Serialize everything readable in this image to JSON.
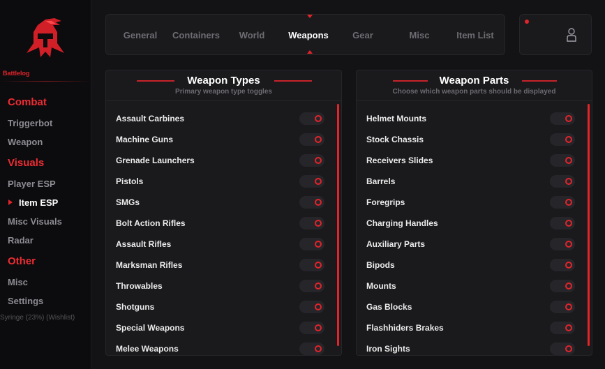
{
  "app": {
    "brand": "Battlelog"
  },
  "sidebar": {
    "sections": [
      {
        "label": "Combat",
        "items": [
          "Triggerbot",
          "Weapon"
        ]
      },
      {
        "label": "Visuals",
        "items": [
          "Player ESP",
          "Item ESP",
          "Misc Visuals",
          "Radar"
        ]
      },
      {
        "label": "Other",
        "items": [
          "Misc",
          "Settings"
        ]
      }
    ],
    "active_item": "Item ESP",
    "footer": "Syringe (23%) (Wishlist)"
  },
  "tabs": {
    "items": [
      "General",
      "Containers",
      "World",
      "Weapons",
      "Gear",
      "Misc",
      "Item List"
    ],
    "active": "Weapons"
  },
  "profile": {
    "icon": "user-icon"
  },
  "panels": {
    "left": {
      "title": "Weapon Types",
      "subtitle": "Primary weapon type toggles",
      "rows": [
        "Assault Carbines",
        "Machine Guns",
        "Grenade Launchers",
        "Pistols",
        "SMGs",
        "Bolt Action Rifles",
        "Assault Rifles",
        "Marksman Rifles",
        "Throwables",
        "Shotguns",
        "Special Weapons",
        "Melee Weapons"
      ]
    },
    "right": {
      "title": "Weapon Parts",
      "subtitle": "Choose which weapon parts should be displayed",
      "rows": [
        "Helmet Mounts",
        "Stock Chassis",
        "Receivers Slides",
        "Barrels",
        "Foregrips",
        "Charging Handles",
        "Auxiliary Parts",
        "Bipods",
        "Mounts",
        "Gas Blocks",
        "Flashhiders Brakes",
        "Iron Sights"
      ]
    }
  },
  "colors": {
    "accent": "#e3242b",
    "background": "#131316",
    "panel": "#1a1a1d"
  }
}
